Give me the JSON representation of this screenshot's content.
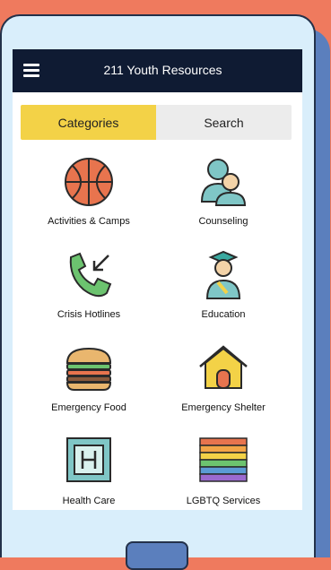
{
  "app": {
    "title": "211 Youth Resources"
  },
  "tabs": [
    {
      "label": "Categories",
      "active": true
    },
    {
      "label": "Search",
      "active": false
    }
  ],
  "categories": [
    {
      "label": "Activities & Camps",
      "icon": "basketball-icon"
    },
    {
      "label": "Counseling",
      "icon": "people-icon"
    },
    {
      "label": "Crisis Hotlines",
      "icon": "phone-call-icon"
    },
    {
      "label": "Education",
      "icon": "graduate-icon"
    },
    {
      "label": "Emergency Food",
      "icon": "burger-icon"
    },
    {
      "label": "Emergency Shelter",
      "icon": "house-icon"
    },
    {
      "label": "Health Care",
      "icon": "hospital-icon"
    },
    {
      "label": "LGBTQ Services",
      "icon": "rainbow-flag-icon"
    }
  ],
  "colors": {
    "header": "#0f1b33",
    "active_tab": "#f3d247",
    "inactive_tab": "#ececec",
    "background": "#ef7a5e",
    "phone_body": "#d9eefb",
    "phone_back": "#5b7fbd"
  }
}
